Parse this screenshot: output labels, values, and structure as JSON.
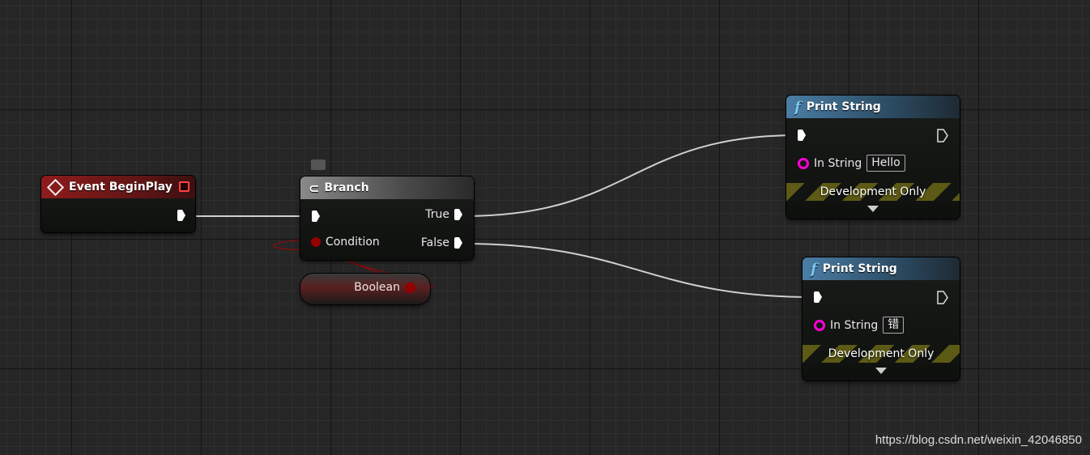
{
  "nodes": {
    "event": {
      "title": "Event BeginPlay",
      "icon": "event-diamond-icon",
      "color": "#8b1a1a"
    },
    "branch": {
      "title": "Branch",
      "icon": "branch-icon",
      "pins": {
        "true": "True",
        "false": "False",
        "condition": "Condition"
      }
    },
    "boolean": {
      "label": "Boolean",
      "color": "#950000"
    },
    "print1": {
      "title": "Print String",
      "icon": "function-icon",
      "in_string_label": "In String",
      "in_string_value": "Hello",
      "dev": "Development Only"
    },
    "print2": {
      "title": "Print String",
      "icon": "function-icon",
      "in_string_label": "In String",
      "in_string_value": "错",
      "dev": "Development Only"
    }
  },
  "colors": {
    "exec": "#ffffff",
    "bool": "#950000",
    "string": "#ff00d4",
    "function_header": "#4b7ea6"
  },
  "watermark": "https://blog.csdn.net/weixin_42046850"
}
